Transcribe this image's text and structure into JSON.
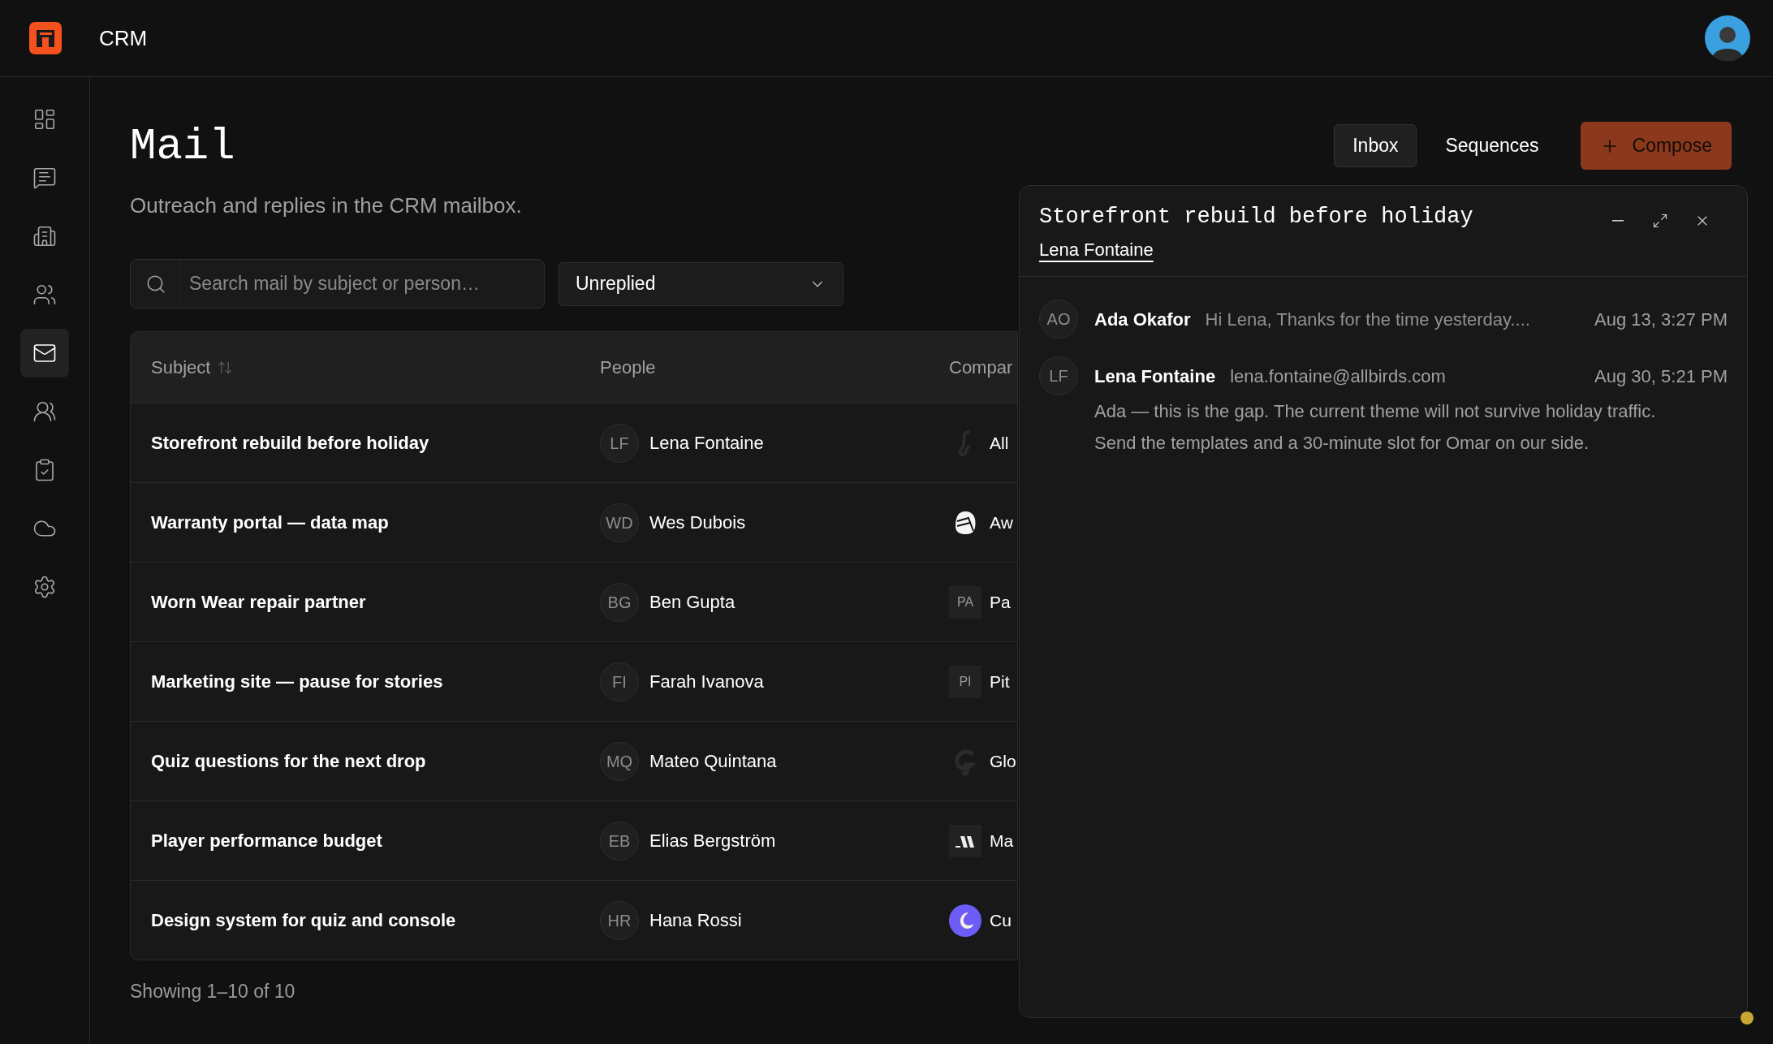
{
  "app": {
    "name": "CRM"
  },
  "sidebar": {
    "items": [
      {
        "selected": false
      },
      {
        "selected": false
      },
      {
        "selected": false
      },
      {
        "selected": false
      },
      {
        "selected": true
      },
      {
        "selected": false
      },
      {
        "selected": false
      },
      {
        "selected": false
      },
      {
        "selected": false
      }
    ]
  },
  "page": {
    "title": "Mail",
    "subtitle": "Outreach and replies in the CRM mailbox."
  },
  "tabs": [
    {
      "label": "Inbox",
      "selected": true
    },
    {
      "label": "Sequences",
      "selected": false
    }
  ],
  "compose_button": {
    "label": "Compose"
  },
  "search": {
    "placeholder": "Search mail by subject or person…"
  },
  "filter": {
    "value": "Unreplied"
  },
  "table": {
    "columns": [
      "Subject",
      "People",
      "Compar"
    ],
    "rows": [
      {
        "subject": "Storefront rebuild before holiday",
        "initials": "LF",
        "person": "Lena Fontaine",
        "company": {
          "kind": "logo",
          "name": "All"
        }
      },
      {
        "subject": "Warranty portal — data map",
        "initials": "WD",
        "person": "Wes Dubois",
        "company": {
          "kind": "logo",
          "name": "Aw"
        }
      },
      {
        "subject": "Worn Wear repair partner",
        "initials": "BG",
        "person": "Ben Gupta",
        "company": {
          "kind": "initials",
          "initials": "PA",
          "name": "Pa"
        }
      },
      {
        "subject": "Marketing site — pause for stories",
        "initials": "FI",
        "person": "Farah Ivanova",
        "company": {
          "kind": "initials",
          "initials": "PI",
          "name": "Pit"
        }
      },
      {
        "subject": "Quiz questions for the next drop",
        "initials": "MQ",
        "person": "Mateo Quintana",
        "company": {
          "kind": "logo",
          "name": "Glo"
        }
      },
      {
        "subject": "Player performance budget",
        "initials": "EB",
        "person": "Elias Bergström",
        "company": {
          "kind": "logo",
          "name": "Ma"
        }
      },
      {
        "subject": "Design system for quiz and console",
        "initials": "HR",
        "person": "Hana Rossi",
        "company": {
          "kind": "logo",
          "name": "Cu"
        }
      }
    ]
  },
  "footer": "Showing 1–10 of 10",
  "thread": {
    "title": "Storefront rebuild before holiday",
    "contact": "Lena Fontaine",
    "messages": [
      {
        "initials": "AO",
        "sender": "Ada Okafor",
        "expanded": false,
        "preview": "Hi Lena, Thanks for the time yesterday....",
        "date": "Aug 13, 3:27 PM"
      },
      {
        "initials": "LF",
        "sender": "Lena Fontaine",
        "expanded": true,
        "email": "lena.fontaine@allbirds.com",
        "date": "Aug 30, 5:21 PM",
        "body": "Ada — this is the gap. The current theme will not survive holiday traffic. Send the templates and a 30-minute slot for Omar on our side."
      }
    ]
  }
}
